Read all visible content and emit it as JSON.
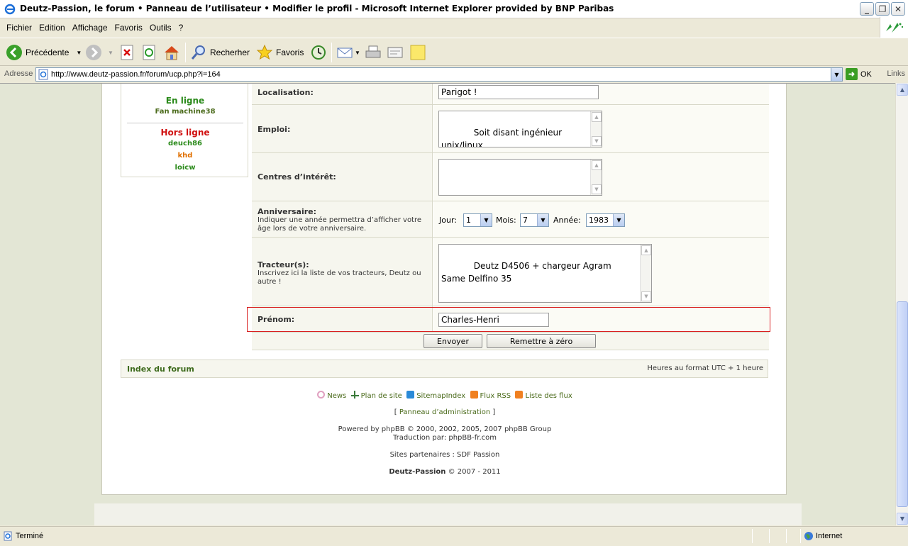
{
  "window": {
    "title": "Deutz-Passion, le forum • Panneau de l’utilisateur • Modifier le profil - Microsoft Internet Explorer provided by BNP Paribas"
  },
  "menu": [
    "Fichier",
    "Edition",
    "Affichage",
    "Favoris",
    "Outils",
    "?"
  ],
  "toolbar": {
    "back": "Précédente",
    "search": "Recherher",
    "favorites": "Favoris"
  },
  "address": {
    "label": "Adresse",
    "url": "http://www.deutz-passion.fr/forum/ucp.php?i=164",
    "go": "OK",
    "links": "Links"
  },
  "who": {
    "online_title": "En ligne",
    "online_users": [
      "Fan machine38"
    ],
    "offline_title": "Hors ligne",
    "offline_users": [
      {
        "name": "deuch86",
        "color": "#2a8a1a"
      },
      {
        "name": "khd",
        "color": "#e07000"
      },
      {
        "name": "loicw",
        "color": "#2a8a1a"
      }
    ],
    "online_color": "#2a8a1a",
    "offline_color": "#d01010"
  },
  "form": {
    "localisation": {
      "label": "Localisation:",
      "value": "Parigot !"
    },
    "emploi": {
      "label": "Emploi:",
      "value": "Soit disant ingénieur\nunix/linux ..."
    },
    "interets": {
      "label": "Centres d’intérêt:",
      "value": ""
    },
    "anniversaire": {
      "label": "Anniversaire:",
      "help": "Indiquer une année permettra d’afficher votre âge lors de votre anniversaire.",
      "jour_label": "Jour:",
      "jour": "1",
      "mois_label": "Mois:",
      "mois": "7",
      "annee_label": "Année:",
      "annee": "1983"
    },
    "tracteurs": {
      "label": "Tracteur(s):",
      "help": "Inscrivez ici la liste de vos tracteurs, Deutz ou autre !",
      "value": "Deutz D4506 + chargeur Agram\nSame Delfino 35"
    },
    "prenom": {
      "label": "Prénom:",
      "value": "Charles-Henri"
    },
    "submit": "Envoyer",
    "reset": "Remettre à zéro"
  },
  "footer": {
    "index": "Index du forum",
    "timezone": "Heures au format UTC + 1 heure",
    "links": [
      "News",
      "Plan de site",
      "SitemapIndex",
      "Flux RSS",
      "Liste des flux"
    ],
    "admin_open": "[",
    "admin": "Panneau d’administration",
    "admin_close": "]",
    "powered": "Powered by phpBB © 2000, 2002, 2005, 2007 phpBB Group",
    "translation": "Traduction par: phpBB-fr.com",
    "partners": "Sites partenaires : SDF Passion",
    "brand": "Deutz-Passion",
    "copyright": "© 2007 - 2011"
  },
  "status": {
    "text": "Terminé",
    "zone": "Internet"
  },
  "colors": {
    "highlight_box": "#d82020"
  }
}
